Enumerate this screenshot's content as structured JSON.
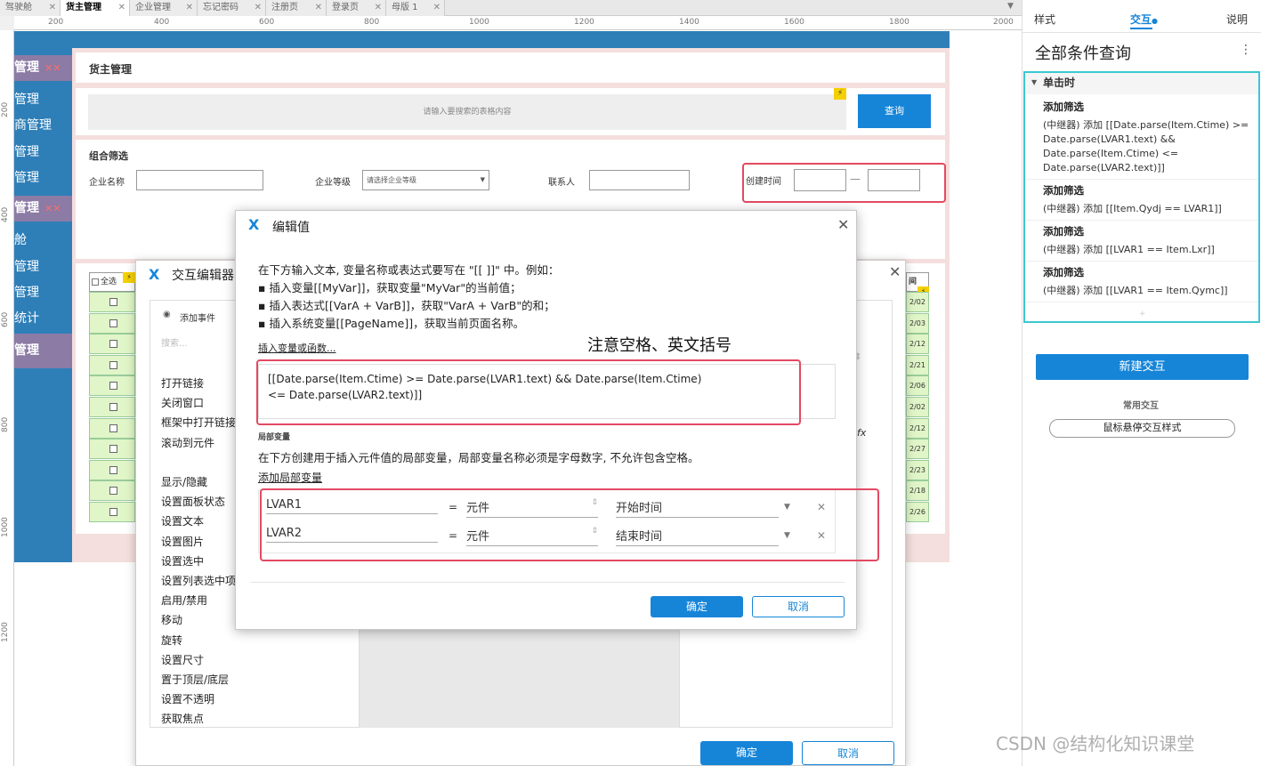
{
  "tabs": [
    {
      "label": "驾驶舱"
    },
    {
      "label": "货主管理"
    },
    {
      "label": "企业管理"
    },
    {
      "label": "忘记密码"
    },
    {
      "label": "注册页"
    },
    {
      "label": "登录页"
    },
    {
      "label": "母版 1"
    }
  ],
  "ruler": {
    "h_ticks": [
      "200",
      "400",
      "600",
      "800",
      "1000",
      "1200",
      "1400",
      "1600",
      "1800",
      "2000"
    ],
    "v_ticks": [
      "200",
      "400",
      "600",
      "800",
      "1000",
      "1200"
    ]
  },
  "canvas": {
    "nav": {
      "section1": "管理",
      "item1": "管理",
      "item2": "商管理",
      "item3": "管理",
      "item4": "管理",
      "section2": "管理",
      "item5": "舱",
      "item6": "管理",
      "item7": "管理",
      "item8": "统计",
      "section3": "管理"
    },
    "page_title": "货主管理",
    "search_placeholder": "请输入要搜索的表格内容",
    "search_button": "查询",
    "filter_title": "组合筛选",
    "company_name_label": "企业名称",
    "company_level_label": "企业等级",
    "company_level_select": "请选择企业等级",
    "contact_label": "联系人",
    "created_time_label": "创建时间",
    "date_separator": "—",
    "select_all": "全选",
    "time_col": "间",
    "date_cells": [
      "2/02",
      "2/03",
      "2/12",
      "2/21",
      "2/06",
      "2/02",
      "2/12",
      "2/27",
      "2/23",
      "2/18",
      "2/26"
    ]
  },
  "interaction_editor": {
    "title": "交互编辑器",
    "add_event": "添加事件",
    "search_placeholder": "搜索...",
    "actions_group1": [
      "打开链接",
      "关闭窗口",
      "框架中打开链接",
      "滚动到元件"
    ],
    "actions_group2": [
      "显示/隐藏",
      "设置面板状态",
      "设置文本",
      "设置图片",
      "设置选中",
      "设置列表选中项",
      "启用/禁用",
      "移动",
      "旋转",
      "设置尺寸",
      "置于顶层/底层",
      "设置不透明",
      "获取焦点"
    ],
    "fx": "fx",
    "ok": "确定",
    "cancel": "取消"
  },
  "edit_value": {
    "title": "编辑值",
    "instructions": [
      "在下方输入文本, 变量名称或表达式要写在 \"[[ ]]\" 中。例如：",
      "▪ 插入变量[[MyVar]]，获取变量\"MyVar\"的当前值；",
      "▪ 插入表达式[[VarA + VarB]]，获取\"VarA + VarB\"的和；",
      "▪ 插入系统变量[[PageName]]，获取当前页面名称。"
    ],
    "insert_link": "插入变量或函数...",
    "annotation": "注意空格、英文括号",
    "expression": "[[Date.parse(Item.Ctime) >= Date.parse(LVAR1.text) && Date.parse(Item.Ctime) <= Date.parse(LVAR2.text)]]",
    "local_vars_heading": "局部变量",
    "local_vars_desc": "在下方创建用于插入元件值的局部变量，局部变量名称必须是字母数字, 不允许包含空格。",
    "add_local_var": "添加局部变量",
    "vars": [
      {
        "name": "LVAR1",
        "eq": "=",
        "type": "元件",
        "target": "开始时间"
      },
      {
        "name": "LVAR2",
        "eq": "=",
        "type": "元件",
        "target": "结束时间"
      }
    ],
    "ok": "确定",
    "cancel": "取消"
  },
  "right_panel": {
    "tabs": [
      "样式",
      "交互",
      "说明"
    ],
    "active_tab": "交互",
    "title": "全部条件查询",
    "event": "单击时",
    "actions": [
      {
        "name": "添加筛选",
        "detail": [
          "(中继器) 添加 [[Date.parse(Item.Ctime) >=",
          "Date.parse(LVAR1.text) &&",
          "Date.parse(Item.Ctime) <=",
          "Date.parse(LVAR2.text)]]"
        ]
      },
      {
        "name": "添加筛选",
        "detail": [
          "(中继器) 添加 [[Item.Qydj == LVAR1]]"
        ]
      },
      {
        "name": "添加筛选",
        "detail": [
          "(中继器) 添加 [[LVAR1 == Item.Lxr]]"
        ]
      },
      {
        "name": "添加筛选",
        "detail": [
          "(中继器) 添加 [[LVAR1 == Item.Qymc]]"
        ]
      }
    ],
    "new_interaction": "新建交互",
    "common_label": "常用交互",
    "hover_style": "鼠标悬停交互样式"
  },
  "watermark": "CSDN @结构化知识课堂",
  "colors": {
    "accent": "#1685d8",
    "highlight": "#e34a62",
    "nav": "#2e7fb8",
    "teal": "#3cc8d0"
  }
}
